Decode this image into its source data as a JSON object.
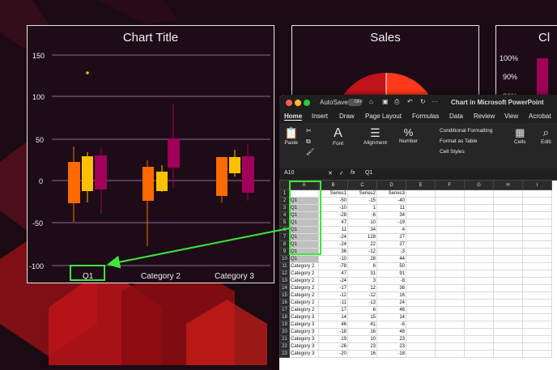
{
  "slide1": {
    "title": "Chart Title",
    "y_ticks": [
      "150",
      "100",
      "50",
      "0",
      "-50",
      "-100"
    ],
    "categories": [
      "Q1",
      "Category 2",
      "Category 3"
    ]
  },
  "slide2": {
    "title": "Sales"
  },
  "slide3": {
    "title": "Cl",
    "ticks": [
      "100%",
      "90%",
      "80%"
    ]
  },
  "excel": {
    "autosave": "AutoSave",
    "autosave_state": "OFF",
    "title": "Chart in Microsoft PowerPoint",
    "tabs": [
      "Home",
      "Insert",
      "Draw",
      "Page Layout",
      "Formulas",
      "Data",
      "Review",
      "View",
      "Acrobat"
    ],
    "ribbon": {
      "paste": "Paste",
      "font": "Font",
      "alignment": "Alignment",
      "number": "Number",
      "conditional": "Conditional Formatting",
      "format_table": "Format as Table",
      "cell_styles": "Cell Styles",
      "cells": "Cells",
      "editing": "Editi"
    },
    "name_box": "A10",
    "fx": "fx",
    "formula": "Q1",
    "columns": [
      "A",
      "B",
      "C",
      "D",
      "E",
      "F",
      "G",
      "H",
      "I"
    ],
    "rows": [
      {
        "n": "1",
        "a": "",
        "b": "Series1",
        "c": "Series2",
        "d": "Series3"
      },
      {
        "n": "2",
        "a": "Q1",
        "b": "-50",
        "c": "-15",
        "d": "-40"
      },
      {
        "n": "3",
        "a": "Q1",
        "b": "-10",
        "c": "1",
        "d": "11"
      },
      {
        "n": "4",
        "a": "Q1",
        "b": "-28",
        "c": "-6",
        "d": "34"
      },
      {
        "n": "5",
        "a": "Q1",
        "b": "47",
        "c": "10",
        "d": "-19"
      },
      {
        "n": "6",
        "a": "Q1",
        "b": "11",
        "c": "34",
        "d": "4"
      },
      {
        "n": "7",
        "a": "Q1",
        "b": "-24",
        "c": "128",
        "d": "27"
      },
      {
        "n": "8",
        "a": "Q1",
        "b": "-24",
        "c": "22",
        "d": "27"
      },
      {
        "n": "9",
        "a": "Q1",
        "b": "36",
        "c": "-12",
        "d": "-3"
      },
      {
        "n": "10",
        "a": "Q1",
        "b": "-10",
        "c": "28",
        "d": "44"
      },
      {
        "n": "11",
        "a": "Category 2",
        "b": "-78",
        "c": "6",
        "d": "50"
      },
      {
        "n": "12",
        "a": "Category 2",
        "b": "47",
        "c": "31",
        "d": "91"
      },
      {
        "n": "13",
        "a": "Category 2",
        "b": "-24",
        "c": "3",
        "d": "-8"
      },
      {
        "n": "14",
        "a": "Category 2",
        "b": "-17",
        "c": "12",
        "d": "36"
      },
      {
        "n": "15",
        "a": "Category 2",
        "b": "-12",
        "c": "-12",
        "d": "16"
      },
      {
        "n": "16",
        "a": "Category 2",
        "b": "-11",
        "c": "-13",
        "d": "24"
      },
      {
        "n": "17",
        "a": "Category 2",
        "b": "17",
        "c": "6",
        "d": "46"
      },
      {
        "n": "18",
        "a": "Category 3",
        "b": "14",
        "c": "15",
        "d": "14"
      },
      {
        "n": "19",
        "a": "Category 3",
        "b": "46",
        "c": "41",
        "d": "-6"
      },
      {
        "n": "20",
        "a": "Category 3",
        "b": "-18",
        "c": "16",
        "d": "48"
      },
      {
        "n": "21",
        "a": "Category 3",
        "b": "19",
        "c": "10",
        "d": "23"
      },
      {
        "n": "22",
        "a": "Category 3",
        "b": "-26",
        "c": "23",
        "d": "23"
      },
      {
        "n": "23",
        "a": "Category 3",
        "b": "-20",
        "c": "16",
        "d": "-18"
      }
    ]
  },
  "colors": {
    "series1": "#ff6a00",
    "series2": "#ffc000",
    "series3": "#a0005a",
    "highlight": "#3ee63e"
  }
}
